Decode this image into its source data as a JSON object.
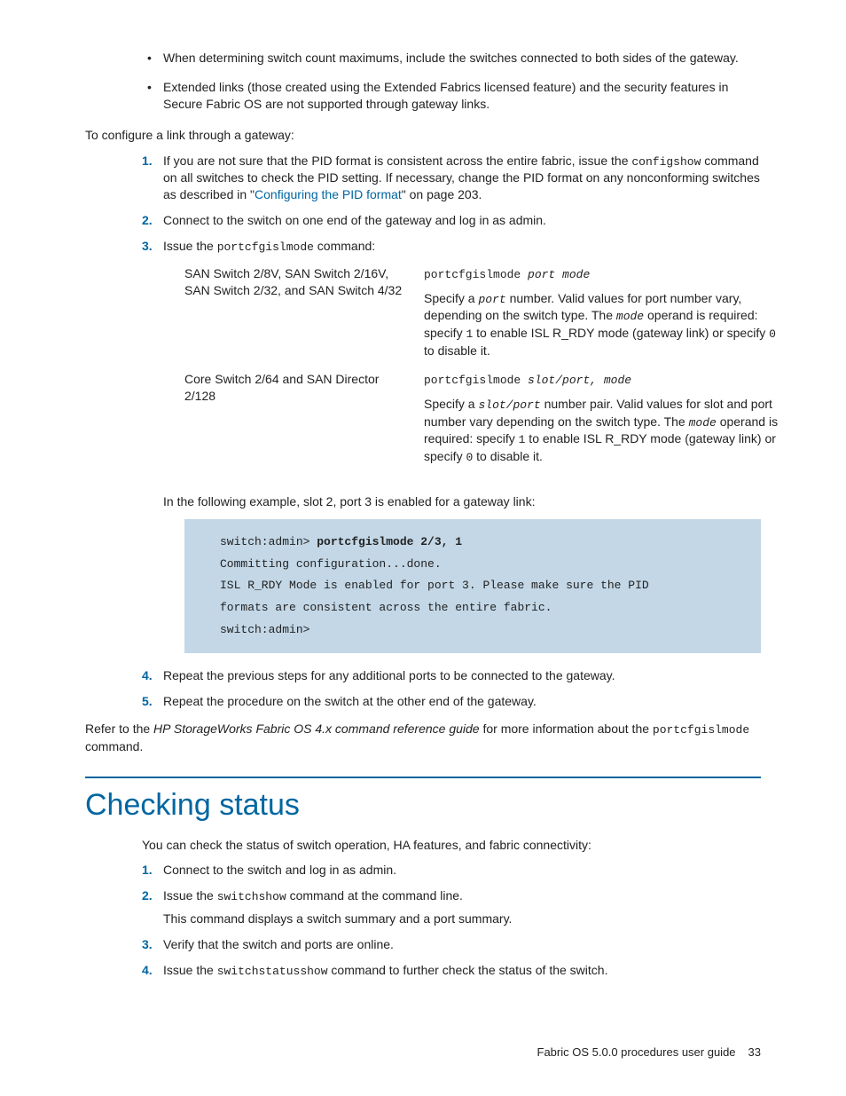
{
  "bullets_top": [
    "When determining switch count maximums, include the switches connected to both sides of the gateway.",
    "Extended links (those created using the Extended Fabrics licensed feature) and the security features in Secure Fabric OS are not supported through gateway links."
  ],
  "lead": "To configure a link through a gateway:",
  "steps1": {
    "s1_a": "If you are not sure that the PID format is consistent across the entire fabric, issue the ",
    "s1_cmd": "configshow",
    "s1_b": " command on all switches to check the PID setting. If necessary, change the PID format on any nonconforming switches as described in \"",
    "s1_link": "Configuring the PID format",
    "s1_c": "\" on page 203.",
    "s2": "Connect to the switch on one end of the gateway and log in as admin.",
    "s3_a": "Issue the ",
    "s3_cmd": "portcfgislmode",
    "s3_b": " command:"
  },
  "cmd_table": {
    "row1": {
      "left": "SAN Switch 2/8V, SAN Switch 2/16V, SAN Switch 2/32, and SAN Switch 4/32",
      "syntax_a": "portcfgislmode ",
      "syntax_b": "port mode",
      "desc_a": "Specify a ",
      "desc_port": "port",
      "desc_b": " number. Valid values for port number vary, depending on the switch type. The ",
      "desc_mode": "mode",
      "desc_c": " operand is required: specify ",
      "desc_1": "1",
      "desc_d": " to enable ISL R_RDY mode (gateway link) or specify ",
      "desc_0": "0",
      "desc_e": " to disable it."
    },
    "row2": {
      "left": "Core Switch 2/64 and SAN Director 2/128",
      "syntax_a": "portcfgislmode ",
      "syntax_b": "slot/port, mode",
      "desc_a": "Specify a ",
      "desc_sp": "slot/port",
      "desc_b": " number pair. Valid values for slot and port number vary depending on the switch type. The ",
      "desc_mode": "mode",
      "desc_c": " operand is required: specify ",
      "desc_1": "1",
      "desc_d": " to enable ISL R_RDY mode (gateway link) or specify ",
      "desc_0": "0",
      "desc_e": " to disable it."
    }
  },
  "example_intro": "In the following example, slot 2, port 3 is enabled for a gateway link:",
  "codeblock": {
    "prompt1": "switch:admin> ",
    "cmd": "portcfgislmode 2/3, 1",
    "l2": "Committing configuration...done.",
    "l3": "ISL R_RDY Mode is enabled for port 3. Please make sure the PID",
    "l4": "formats are consistent across the entire fabric.",
    "l5": "switch:admin>"
  },
  "steps1_cont": {
    "s4": "Repeat the previous steps for any additional ports to be connected to the gateway.",
    "s5": "Repeat the procedure on the switch at the other end of the gateway."
  },
  "refer": {
    "a": "Refer to the ",
    "i": "HP StorageWorks Fabric OS 4.x command reference guide",
    "b": " for more information about the ",
    "cmd": "portcfgislmode",
    "c": " command."
  },
  "section_title": "Checking status",
  "status_lead": "You can check the status of switch operation, HA features, and fabric connectivity:",
  "steps2": {
    "s1": "Connect to the switch and log in as admin.",
    "s2_a": "Issue the ",
    "s2_cmd": "switchshow",
    "s2_b": " command at the command line.",
    "s2_sub": "This command displays a switch summary and a port summary.",
    "s3": "Verify that the switch and ports are online.",
    "s4_a": "Issue the ",
    "s4_cmd": "switchstatusshow",
    "s4_b": " command to further check the status of the switch."
  },
  "footer": {
    "title": "Fabric OS 5.0.0 procedures user guide",
    "page": "33"
  }
}
